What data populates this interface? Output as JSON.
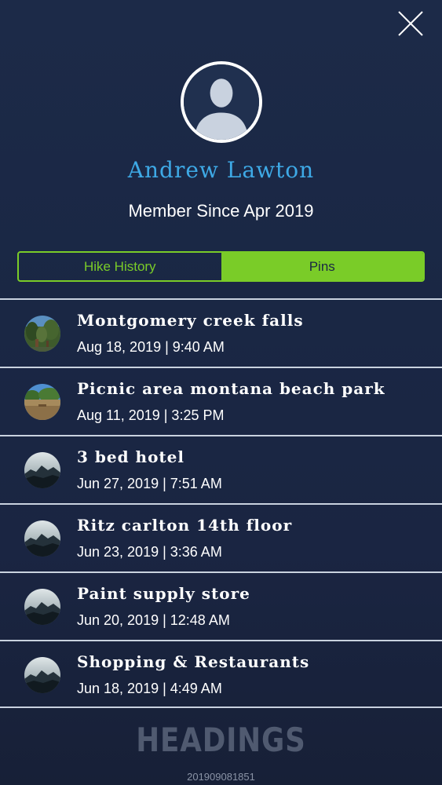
{
  "profile": {
    "name": "Andrew Lawton",
    "member_since": "Member Since Apr 2019"
  },
  "tabs": [
    {
      "label": "Hike History",
      "active": false
    },
    {
      "label": "Pins",
      "active": true
    }
  ],
  "pins": [
    {
      "title": "Montgomery creek falls",
      "date": "Aug 18, 2019 | 9:40 AM",
      "thumb": "forest-photo"
    },
    {
      "title": "Picnic area montana beach park",
      "date": "Aug 11, 2019 | 3:25 PM",
      "thumb": "beach-park-photo"
    },
    {
      "title": "3 bed hotel",
      "date": "Jun 27, 2019 | 7:51 AM",
      "thumb": "mountain-placeholder"
    },
    {
      "title": "Ritz carlton 14th floor",
      "date": "Jun 23, 2019 | 3:36 AM",
      "thumb": "mountain-placeholder"
    },
    {
      "title": "Paint supply store",
      "date": "Jun 20, 2019 | 12:48 AM",
      "thumb": "mountain-placeholder"
    },
    {
      "title": "Shopping & Restaurants",
      "date": "Jun 18, 2019 | 4:49 AM",
      "thumb": "mountain-placeholder"
    }
  ],
  "footer": {
    "brand": "HEADINGS",
    "build": "201909081851"
  },
  "colors": {
    "accent_green": "#7acc28",
    "name_blue": "#3ea9e6",
    "background": "#1a2744"
  },
  "icons": {
    "close": "close-icon",
    "avatar": "user-silhouette-icon"
  }
}
